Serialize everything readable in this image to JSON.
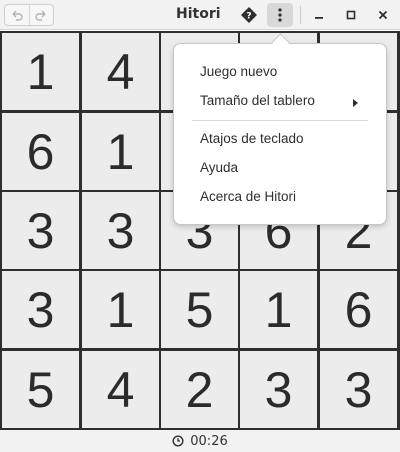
{
  "window": {
    "title": "Hitori",
    "undo_icon": "undo-icon",
    "redo_icon": "redo-icon",
    "hint_icon": "hint-icon",
    "menu_icon": "kebab-menu-icon",
    "minimize_icon": "minimize-icon",
    "maximize_icon": "maximize-icon",
    "close_icon": "close-icon"
  },
  "board": {
    "rows": [
      [
        "1",
        "4",
        "",
        "",
        ""
      ],
      [
        "6",
        "1",
        "",
        "",
        ""
      ],
      [
        "3",
        "3",
        "3",
        "6",
        "2"
      ],
      [
        "3",
        "1",
        "5",
        "1",
        "6"
      ],
      [
        "5",
        "4",
        "2",
        "3",
        "3"
      ]
    ]
  },
  "menu": {
    "items": [
      {
        "label": "Juego nuevo"
      },
      {
        "label": "Tamaño del tablero",
        "has_submenu": true
      },
      {
        "label": "Atajos de teclado"
      },
      {
        "label": "Ayuda"
      },
      {
        "label": "Acerca de Hitori"
      }
    ]
  },
  "status": {
    "clock_icon": "clock-icon",
    "time": "00:26"
  }
}
